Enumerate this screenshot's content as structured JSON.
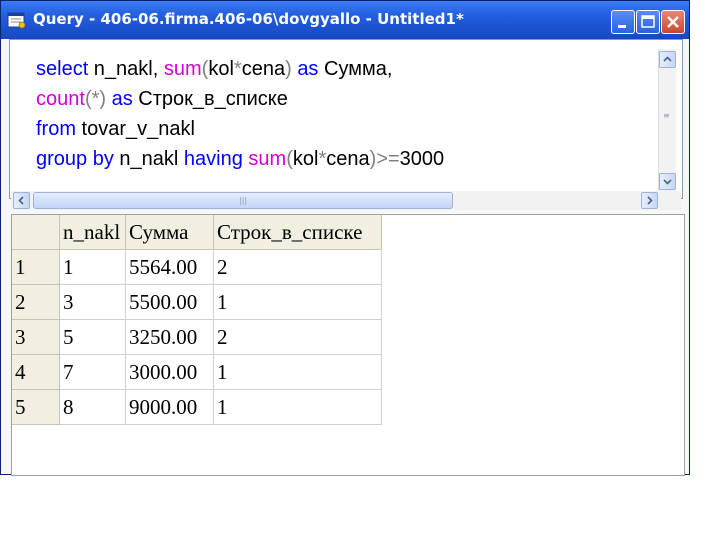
{
  "window": {
    "title": "Query - 406-06.firma.406-06\\dovgyallo - Untitled1*"
  },
  "titlebar_buttons": [
    "minimize-icon",
    "maximize-icon",
    "close-icon"
  ],
  "editor": {
    "lines": [
      [
        {
          "t": "select",
          "c": "kw"
        },
        {
          "t": " n_nakl, ",
          "c": ""
        },
        {
          "t": "sum",
          "c": "fn"
        },
        {
          "t": "(",
          "c": "pn"
        },
        {
          "t": "kol",
          "c": ""
        },
        {
          "t": "*",
          "c": "pn"
        },
        {
          "t": "cena",
          "c": ""
        },
        {
          "t": ")",
          "c": "pn"
        },
        {
          "t": " ",
          "c": ""
        },
        {
          "t": "as",
          "c": "kw"
        },
        {
          "t": " Сумма,",
          "c": ""
        }
      ],
      [
        {
          "t": "count",
          "c": "fn"
        },
        {
          "t": "(*)",
          "c": "pn"
        },
        {
          "t": " ",
          "c": ""
        },
        {
          "t": "as",
          "c": "kw"
        },
        {
          "t": " Строк_в_списке",
          "c": ""
        }
      ],
      [
        {
          "t": "from",
          "c": "kw"
        },
        {
          "t": " tovar_v_nakl",
          "c": ""
        }
      ],
      [
        {
          "t": "group by",
          "c": "kw"
        },
        {
          "t": " n_nakl ",
          "c": ""
        },
        {
          "t": "having",
          "c": "kw"
        },
        {
          "t": " ",
          "c": ""
        },
        {
          "t": "sum",
          "c": "fn"
        },
        {
          "t": "(",
          "c": "pn"
        },
        {
          "t": "kol",
          "c": ""
        },
        {
          "t": "*",
          "c": "pn"
        },
        {
          "t": "cena",
          "c": ""
        },
        {
          "t": ")>=",
          "c": "pn"
        },
        {
          "t": "3000",
          "c": ""
        }
      ]
    ]
  },
  "results": {
    "columns": [
      "n_nakl",
      "Сумма",
      "Строк_в_списке"
    ],
    "rows": [
      {
        "num": "1",
        "cells": [
          "1",
          "5564.00",
          "2"
        ]
      },
      {
        "num": "2",
        "cells": [
          "3",
          "5500.00",
          "1"
        ]
      },
      {
        "num": "3",
        "cells": [
          "5",
          "3250.00",
          "2"
        ]
      },
      {
        "num": "4",
        "cells": [
          "7",
          "3000.00",
          "1"
        ]
      },
      {
        "num": "5",
        "cells": [
          "8",
          "9000.00",
          "1"
        ]
      }
    ]
  },
  "colors": {
    "keyword": "#0000ff",
    "function": "#d400d4",
    "punctuation": "#808080",
    "titlebar": "#2460e0"
  }
}
